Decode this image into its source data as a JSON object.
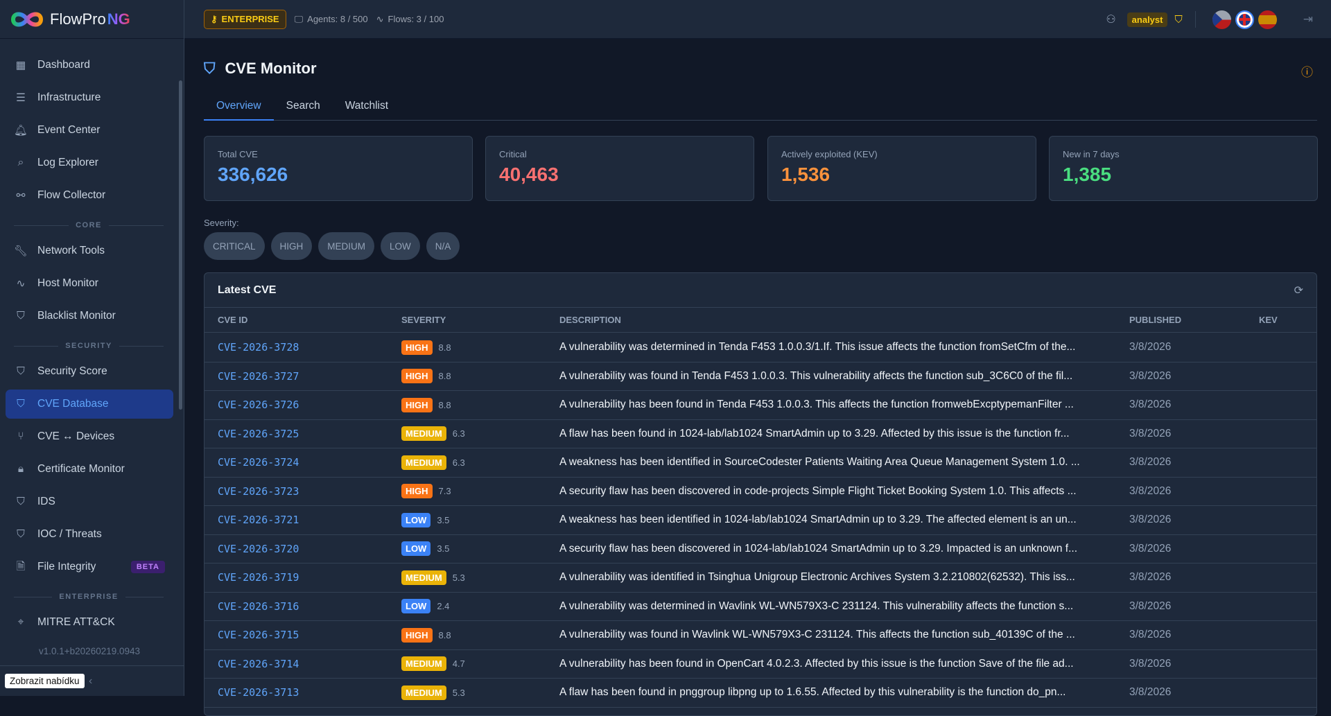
{
  "app": {
    "name": "FlowPro",
    "name_suffix": "NG"
  },
  "topbar": {
    "license": "ENTERPRISE",
    "agents": "Agents: 8 / 500",
    "flows": "Flows: 3 / 100",
    "role": "analyst",
    "languages": [
      "cs",
      "en",
      "es"
    ],
    "active_language": "en"
  },
  "sidebar": {
    "items": [
      {
        "label": "Dashboard",
        "icon": "dashboard-icon"
      },
      {
        "label": "Infrastructure",
        "icon": "server-icon"
      },
      {
        "label": "Event Center",
        "icon": "bell-icon"
      },
      {
        "label": "Log Explorer",
        "icon": "search-icon"
      },
      {
        "label": "Flow Collector",
        "icon": "network-icon"
      },
      {
        "label": "Network Tools",
        "icon": "wrench-icon"
      },
      {
        "label": "Host Monitor",
        "icon": "activity-icon"
      },
      {
        "label": "Blacklist Monitor",
        "icon": "shield-off-icon"
      },
      {
        "label": "Security Score",
        "icon": "shield-icon"
      },
      {
        "label": "CVE Database",
        "icon": "shield-check-icon"
      },
      {
        "label": "CVE ↔ Devices",
        "icon": "git-link-icon"
      },
      {
        "label": "Certificate Monitor",
        "icon": "lock-icon"
      },
      {
        "label": "IDS",
        "icon": "shield-alert-icon"
      },
      {
        "label": "IOC / Threats",
        "icon": "shield-icon"
      },
      {
        "label": "File Integrity",
        "icon": "file-search-icon",
        "badge": "BETA"
      },
      {
        "label": "MITRE ATT&CK",
        "icon": "crosshair-icon"
      }
    ],
    "sections": [
      "CORE",
      "SECURITY",
      "ENTERPRISE"
    ],
    "version": "v1.0.1+b20260219.0943",
    "tooltip": "Zobrazit nabídku"
  },
  "page": {
    "title": "CVE Monitor",
    "tabs": [
      "Overview",
      "Search",
      "Watchlist"
    ],
    "active_tab": "Overview"
  },
  "stats": [
    {
      "label": "Total CVE",
      "value": "336,626",
      "color": "#60a5fa"
    },
    {
      "label": "Critical",
      "value": "40,463",
      "color": "#f87171"
    },
    {
      "label": "Actively exploited (KEV)",
      "value": "1,536",
      "color": "#fb923c"
    },
    {
      "label": "New in 7 days",
      "value": "1,385",
      "color": "#4ade80"
    }
  ],
  "severity_filter": {
    "label": "Severity:",
    "options": [
      "CRITICAL",
      "HIGH",
      "MEDIUM",
      "LOW",
      "N/A"
    ]
  },
  "table": {
    "title": "Latest CVE",
    "columns": [
      "CVE ID",
      "SEVERITY",
      "DESCRIPTION",
      "PUBLISHED",
      "KEV"
    ],
    "severity_colors": {
      "HIGH": "#f97316",
      "MEDIUM": "#eab308",
      "LOW": "#3b82f6"
    },
    "rows": [
      {
        "id": "CVE-2026-3728",
        "sev": "HIGH",
        "score": "8.8",
        "desc": "A vulnerability was determined in Tenda F453 1.0.0.3/1.If. This issue affects the function fromSetCfm of the...",
        "pub": "3/8/2026"
      },
      {
        "id": "CVE-2026-3727",
        "sev": "HIGH",
        "score": "8.8",
        "desc": "A vulnerability was found in Tenda F453 1.0.0.3. This vulnerability affects the function sub_3C6C0 of the fil...",
        "pub": "3/8/2026"
      },
      {
        "id": "CVE-2026-3726",
        "sev": "HIGH",
        "score": "8.8",
        "desc": "A vulnerability has been found in Tenda F453 1.0.0.3. This affects the function fromwebExcptypemanFilter ...",
        "pub": "3/8/2026"
      },
      {
        "id": "CVE-2026-3725",
        "sev": "MEDIUM",
        "score": "6.3",
        "desc": "A flaw has been found in 1024-lab/lab1024 SmartAdmin up to 3.29. Affected by this issue is the function fr...",
        "pub": "3/8/2026"
      },
      {
        "id": "CVE-2026-3724",
        "sev": "MEDIUM",
        "score": "6.3",
        "desc": "A weakness has been identified in SourceCodester Patients Waiting Area Queue Management System 1.0. ...",
        "pub": "3/8/2026"
      },
      {
        "id": "CVE-2026-3723",
        "sev": "HIGH",
        "score": "7.3",
        "desc": "A security flaw has been discovered in code-projects Simple Flight Ticket Booking System 1.0. This affects ...",
        "pub": "3/8/2026"
      },
      {
        "id": "CVE-2026-3721",
        "sev": "LOW",
        "score": "3.5",
        "desc": "A weakness has been identified in 1024-lab/lab1024 SmartAdmin up to 3.29. The affected element is an un...",
        "pub": "3/8/2026"
      },
      {
        "id": "CVE-2026-3720",
        "sev": "LOW",
        "score": "3.5",
        "desc": "A security flaw has been discovered in 1024-lab/lab1024 SmartAdmin up to 3.29. Impacted is an unknown f...",
        "pub": "3/8/2026"
      },
      {
        "id": "CVE-2026-3719",
        "sev": "MEDIUM",
        "score": "5.3",
        "desc": "A vulnerability was identified in Tsinghua Unigroup Electronic Archives System 3.2.210802(62532). This iss...",
        "pub": "3/8/2026"
      },
      {
        "id": "CVE-2026-3716",
        "sev": "LOW",
        "score": "2.4",
        "desc": "A vulnerability was determined in Wavlink WL-WN579X3-C 231124. This vulnerability affects the function s...",
        "pub": "3/8/2026"
      },
      {
        "id": "CVE-2026-3715",
        "sev": "HIGH",
        "score": "8.8",
        "desc": "A vulnerability was found in Wavlink WL-WN579X3-C 231124. This affects the function sub_40139C of the ...",
        "pub": "3/8/2026"
      },
      {
        "id": "CVE-2026-3714",
        "sev": "MEDIUM",
        "score": "4.7",
        "desc": "A vulnerability has been found in OpenCart 4.0.2.3. Affected by this issue is the function Save of the file ad...",
        "pub": "3/8/2026"
      },
      {
        "id": "CVE-2026-3713",
        "sev": "MEDIUM",
        "score": "5.3",
        "desc": "A flaw has been found in pnggroup libpng up to 1.6.55. Affected by this vulnerability is the function do_pn...",
        "pub": "3/8/2026"
      }
    ]
  }
}
